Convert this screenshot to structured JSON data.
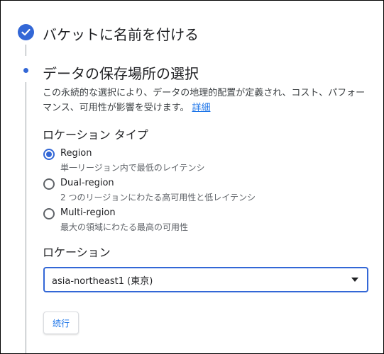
{
  "step1": {
    "title": "バケットに名前を付ける",
    "status_icon": "check-circle-icon"
  },
  "step2": {
    "title": "データの保存場所の選択",
    "description": "この永続的な選択により、データの地理的配置が定義され、コスト、パフォーマンス、可用性が影響を受けます。",
    "learn_more": "詳細",
    "location_type": {
      "label": "ロケーション タイプ",
      "options": [
        {
          "label": "Region",
          "description": "単一リージョン内で最低のレイテンシ",
          "selected": true
        },
        {
          "label": "Dual-region",
          "description": "2 つのリージョンにわたる高可用性と低レイテンシ",
          "selected": false
        },
        {
          "label": "Multi-region",
          "description": "最大の領域にわたる最高の可用性",
          "selected": false
        }
      ]
    },
    "location": {
      "label": "ロケーション",
      "value": "asia-northeast1 (東京)"
    },
    "continue_label": "続行"
  },
  "colors": {
    "accent": "#3367d6",
    "link": "#1a73e8",
    "rail": "#9aa0a6"
  }
}
